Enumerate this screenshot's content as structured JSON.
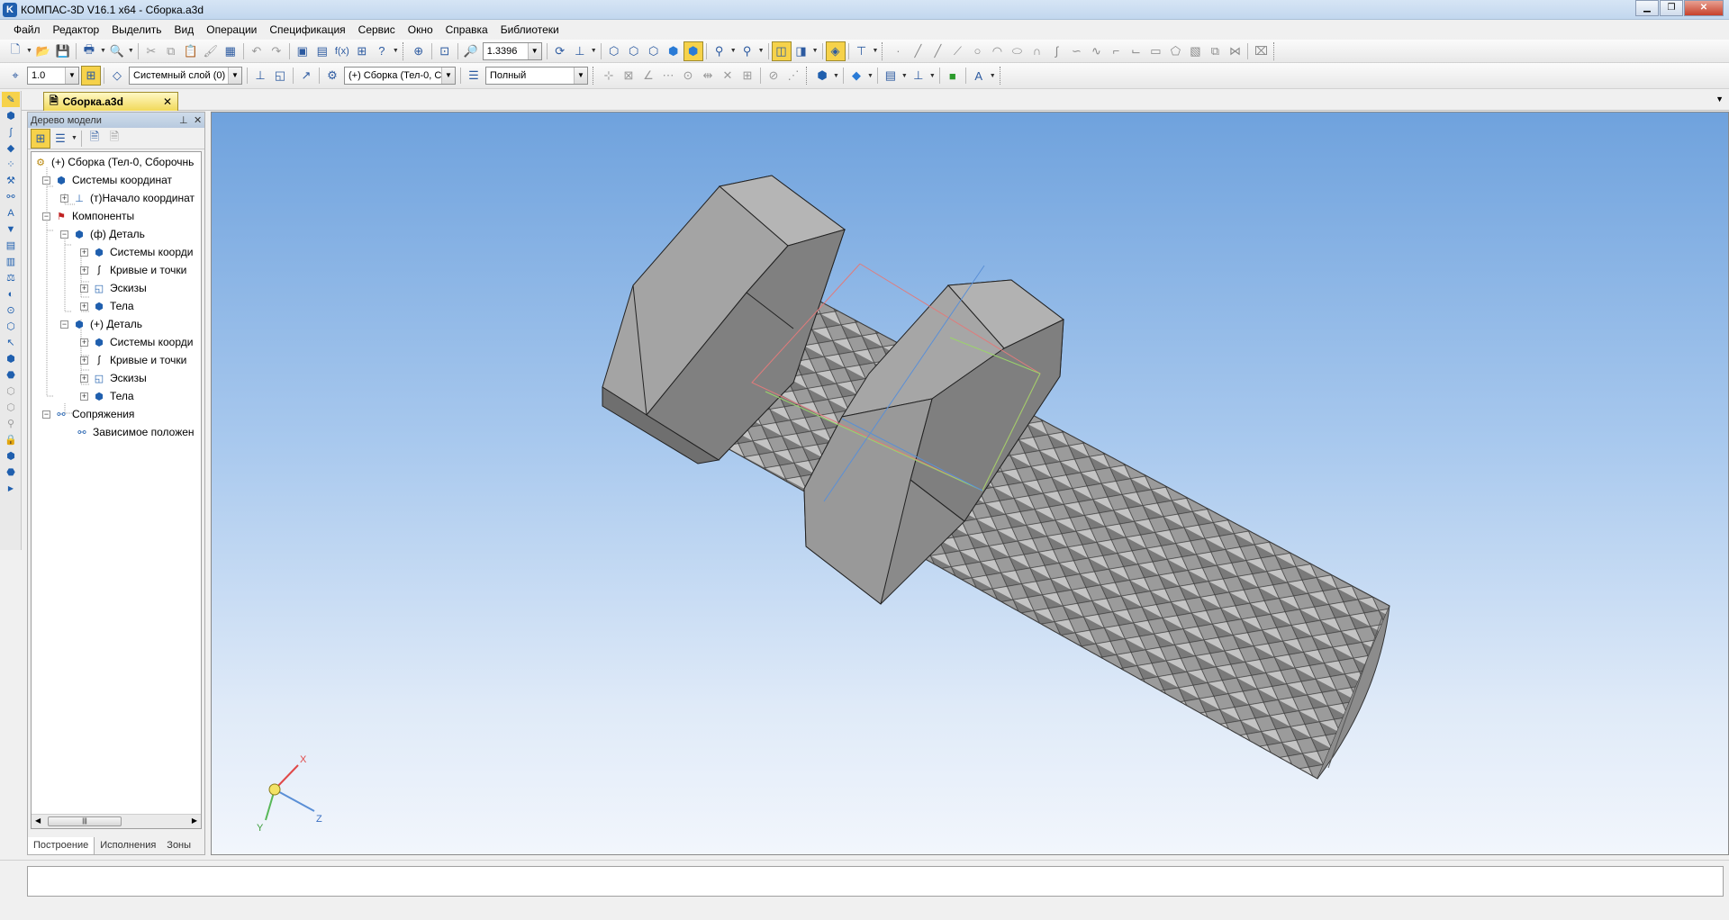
{
  "window": {
    "title": "КОМПАС-3D V16.1 x64 - Сборка.a3d"
  },
  "menu": [
    "Файл",
    "Редактор",
    "Выделить",
    "Вид",
    "Операции",
    "Спецификация",
    "Сервис",
    "Окно",
    "Справка",
    "Библиотеки"
  ],
  "toolbar1": {
    "zoom_value": "1.3396"
  },
  "toolbar2": {
    "step_value": "1.0",
    "layer_value": "Системный слой (0)",
    "component_value": "(+) Сборка (Тел-0, С",
    "display_mode": "Полный"
  },
  "document_tab": {
    "label": "Сборка.a3d",
    "close": "✕"
  },
  "tree_panel": {
    "title": "Дерево модели",
    "nodes": [
      {
        "label": "(+) Сборка (Тел-0, Сборочнь"
      },
      {
        "label": "Системы координат"
      },
      {
        "label": "(т)Начало координат"
      },
      {
        "label": "Компоненты"
      },
      {
        "label": "(ф) Деталь"
      },
      {
        "label": "Системы коорди"
      },
      {
        "label": "Кривые и точки"
      },
      {
        "label": "Эскизы"
      },
      {
        "label": "Тела"
      },
      {
        "label": "(+) Деталь"
      },
      {
        "label": "Системы коорди"
      },
      {
        "label": "Кривые и точки"
      },
      {
        "label": "Эскизы"
      },
      {
        "label": "Тела"
      },
      {
        "label": "Сопряжения"
      },
      {
        "label": "Зависимое положен"
      }
    ],
    "bottom_tabs": [
      "Построение",
      "Исполнения",
      "Зоны"
    ]
  },
  "triad": {
    "x_label": "X",
    "y_label": "Y",
    "z_label": "Z"
  },
  "colors": {
    "bolt_gray": "#9a9a9a",
    "viewport_top": "#6fa2dd",
    "viewport_bottom": "#f2f6fc"
  },
  "icons": {
    "close": "close-icon",
    "pin": "pin-icon"
  }
}
